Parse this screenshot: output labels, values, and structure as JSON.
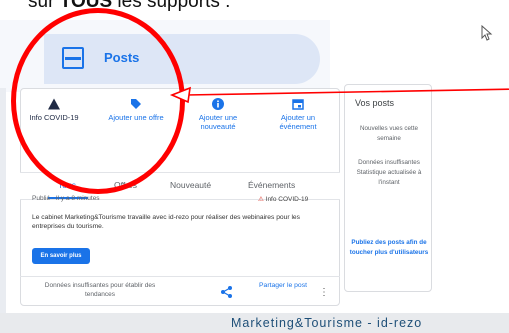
{
  "heading": {
    "prefix": "sur ",
    "bold": "TOUS",
    "suffix": " les supports :"
  },
  "panel": {
    "title": "Posts"
  },
  "actions": [
    {
      "label": "Info COVID-19",
      "icon": "warning-triangle-icon"
    },
    {
      "label": "Ajouter une offre",
      "icon": "tag-icon"
    },
    {
      "label": "Ajouter une nouveauté",
      "icon": "info-circle-icon"
    },
    {
      "label": "Ajouter un événement",
      "icon": "calendar-icon"
    }
  ],
  "tabs": [
    "Tous",
    "Offres",
    "Nouveauté",
    "Événements"
  ],
  "post": {
    "meta": "Publié · Il y a 8 minutes",
    "badge": "Info COVID-19",
    "text": "Le cabinet Marketing&Tourisme travaille avec id-rezo pour réaliser des webinaires pour les entreprises du tourisme.",
    "button": "En savoir plus",
    "insufficient": "Données insuffisantes pour établir des tendances",
    "share": "Partager le post"
  },
  "side": {
    "title": "Vos posts",
    "stat_label": "Nouvelles vues cette semaine",
    "stat_value": "Données insuffisantes Statistique actualisée à l'instant",
    "cta": "Publiez des posts afin de toucher plus d'utilisateurs"
  },
  "banner": "Marketing&Tourisme - id-rezo",
  "colors": {
    "accent": "#1a73e8",
    "annotation": "#ff0000",
    "banner_text": "#1e4f78"
  }
}
